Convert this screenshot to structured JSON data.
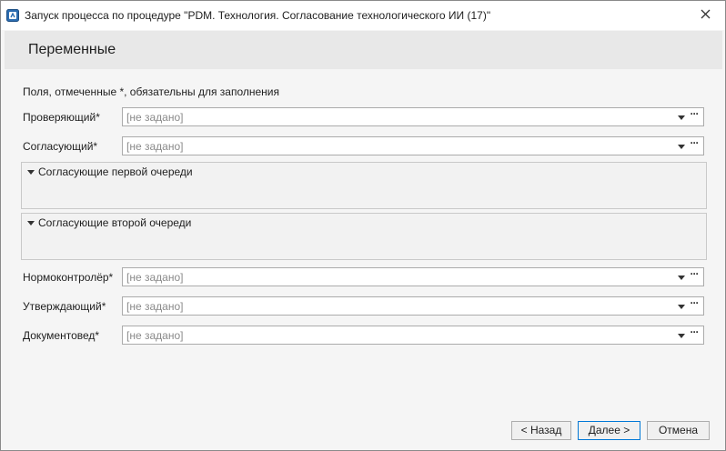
{
  "window": {
    "title": "Запуск процесса по процедуре \"PDM. Технология. Согласование технологического ИИ (17)\"",
    "close_glyph": "✕"
  },
  "header": {
    "title": "Переменные"
  },
  "hint": "Поля, отмеченные *, обязательны для заполнения",
  "fields_top": [
    {
      "label": "Проверяющий*",
      "value": "[не задано]"
    },
    {
      "label": "Согласующий*",
      "value": "[не задано]"
    }
  ],
  "groups": [
    {
      "title": "Согласующие первой очереди"
    },
    {
      "title": "Согласующие второй очереди"
    }
  ],
  "fields_bottom": [
    {
      "label": "Нормоконтролёр*",
      "value": "[не задано]"
    },
    {
      "label": "Утверждающий*",
      "value": "[не задано]"
    },
    {
      "label": "Документовед*",
      "value": "[не задано]"
    }
  ],
  "more_glyph": "···",
  "buttons": {
    "back": "< Назад",
    "next": "Далее >",
    "cancel": "Отмена"
  },
  "colors": {
    "accent": "#0078d7",
    "icon_blue": "#2b6cb0"
  }
}
